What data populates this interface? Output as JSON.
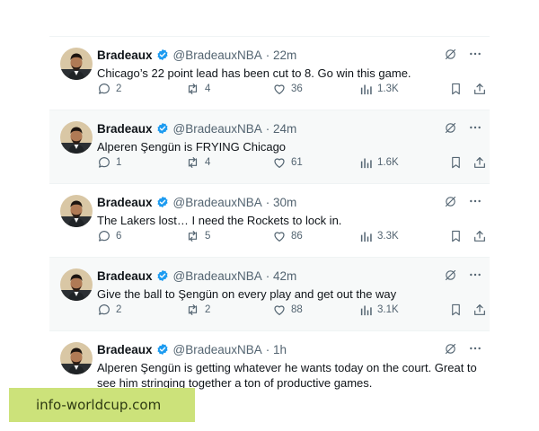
{
  "colors": {
    "accent": "#1d9bf0",
    "muted": "#536471",
    "banner_bg": "#cce27a"
  },
  "tweets": [
    {
      "name": "Bradeaux",
      "handle": "@BradeauxNBA",
      "time": "· 22m",
      "text": "Chicago’s 22 point lead has been cut to 8. Go win this game.",
      "replies": "2",
      "retweets": "4",
      "likes": "36",
      "views": "1.3K"
    },
    {
      "name": "Bradeaux",
      "handle": "@BradeauxNBA",
      "time": "· 24m",
      "text": "Alperen Şengün is FRYING Chicago",
      "replies": "1",
      "retweets": "4",
      "likes": "61",
      "views": "1.6K"
    },
    {
      "name": "Bradeaux",
      "handle": "@BradeauxNBA",
      "time": "· 30m",
      "text": "The Lakers lost… I need the Rockets to lock in.",
      "replies": "6",
      "retweets": "5",
      "likes": "86",
      "views": "3.3K"
    },
    {
      "name": "Bradeaux",
      "handle": "@BradeauxNBA",
      "time": "· 42m",
      "text": "Give the ball to Şengün on every play and get out the way",
      "replies": "2",
      "retweets": "2",
      "likes": "88",
      "views": "3.1K"
    },
    {
      "name": "Bradeaux",
      "handle": "@BradeauxNBA",
      "time": "· 1h",
      "text": "Alperen Şengün is getting whatever he wants today on the court. Great to see him stringing together a ton of productive games."
    }
  ],
  "icons": [
    "verified-icon",
    "grok-icon",
    "more-icon",
    "reply-icon",
    "retweet-icon",
    "like-icon",
    "views-icon",
    "bookmark-icon",
    "share-icon"
  ],
  "watermark": {
    "text": "info-worldcup.com"
  }
}
